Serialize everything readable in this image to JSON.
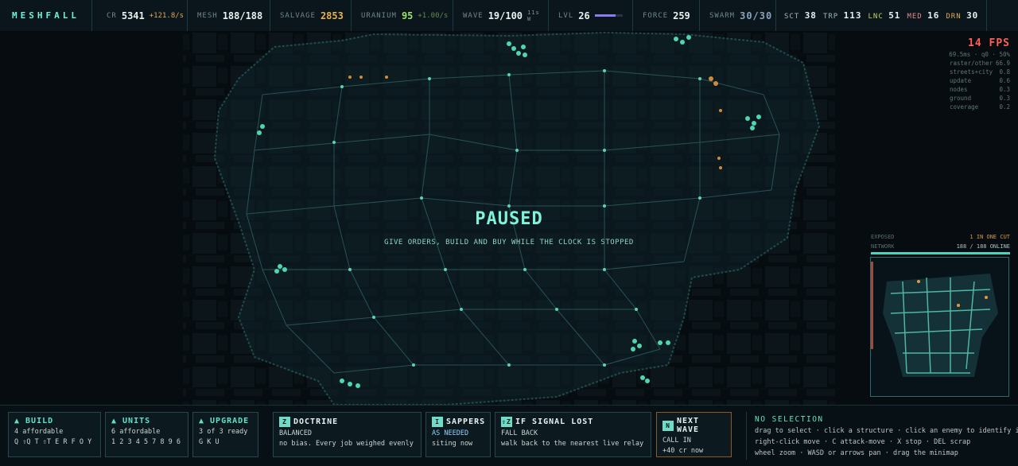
{
  "brand": "MESHFALL",
  "top": {
    "cr": {
      "label": "CR",
      "value": "5341",
      "rate": "+121.8/s"
    },
    "mesh": {
      "label": "MESH",
      "value": "188/188"
    },
    "salvage": {
      "label": "SALVAGE",
      "value": "2853"
    },
    "uranium": {
      "label": "URANIUM",
      "value": "95",
      "rate": "+1.00/s"
    },
    "wave": {
      "label": "WAVE",
      "value": "19/100",
      "timer": "11s",
      "timer_unit": "W"
    },
    "lvl": {
      "label": "LVL",
      "value": "26",
      "progress": 0.75
    },
    "force": {
      "label": "FORCE",
      "value": "259"
    },
    "swarm": {
      "label": "SWARM",
      "value": "30/30"
    },
    "units": [
      {
        "label": "SCT",
        "value": "38"
      },
      {
        "label": "TRP",
        "value": "113"
      },
      {
        "label": "LNC",
        "value": "51"
      },
      {
        "label": "MED",
        "value": "16"
      },
      {
        "label": "DRN",
        "value": "30"
      }
    ]
  },
  "overlay": {
    "title": "PAUSED",
    "subtitle": "GIVE ORDERS, BUILD AND BUY WHILE THE CLOCK IS STOPPED"
  },
  "perf": {
    "fps": "14 FPS",
    "frame": "69.5ms · q0 · 50%",
    "rows": [
      {
        "name": "raster/other",
        "value": "66.9"
      },
      {
        "name": "streets+city",
        "value": "0.8"
      },
      {
        "name": "update",
        "value": "0.6"
      },
      {
        "name": "nodes",
        "value": "0.3"
      },
      {
        "name": "ground",
        "value": "0.3"
      },
      {
        "name": "coverage",
        "value": "0.2"
      }
    ]
  },
  "minimap": {
    "exposed_label": "EXPOSED",
    "exposed_value": "1 IN ONE CUT",
    "network_label": "NETWORK",
    "network_value": "188 / 188 ONLINE"
  },
  "cards": {
    "build": {
      "title": "▲ BUILD",
      "line1": "4 affordable",
      "line2": "Q ⇧Q T ⇧T E R F O Y"
    },
    "units": {
      "title": "▲ UNITS",
      "line1": "6 affordable",
      "line2": "1 2 3 4 5 7 8 9 6"
    },
    "upgrade": {
      "title": "▲ UPGRADE",
      "line1": "3 of 3 ready",
      "line2": "G K U"
    },
    "doctrine": {
      "key": "Z",
      "title": "DOCTRINE",
      "line1": "BALANCED",
      "line2": "no bias. Every job weighed evenly"
    },
    "sappers": {
      "key": "I",
      "title": "SAPPERS",
      "line1a": "AS",
      "line1b": "NEEDED",
      "line2": "siting now"
    },
    "signal": {
      "key": "⇧Z",
      "title": "IF SIGNAL LOST",
      "line1": "FALL BACK",
      "line2": "walk back to the nearest live relay"
    },
    "nextwave": {
      "key": "N",
      "title": "NEXT WAVE",
      "line1": "CALL IN",
      "line2": "+40 cr now"
    }
  },
  "selection": {
    "title": "NO SELECTION",
    "lines": [
      "drag to select · click a structure · click an enemy to identify it",
      "right-click move · C attack-move · X stop · DEL scrap",
      "wheel zoom · WASD or arrows pan · drag the minimap"
    ]
  },
  "colors": {
    "accent": "#5fe1c8",
    "warn": "#e09a44",
    "fps": "#ff5f56",
    "level": "#8b7cf0"
  }
}
